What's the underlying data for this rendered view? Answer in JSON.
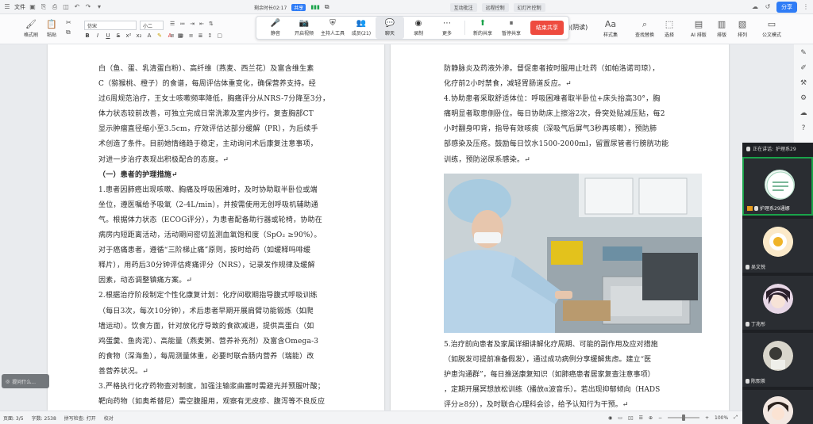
{
  "titlebar": {
    "file_menu": "文件",
    "share_label": "分享"
  },
  "meeting": {
    "timer": "剩余时长02:17",
    "badge": "共享",
    "tabs": [
      "互动批注",
      "远程控制",
      "幻灯片控制"
    ],
    "items": [
      {
        "label": "静音",
        "icon": "microphone-icon"
      },
      {
        "label": "开启视频",
        "icon": "camera-icon"
      },
      {
        "label": "主持人工具",
        "icon": "shield-icon"
      },
      {
        "label": "成员(21)",
        "icon": "members-icon"
      },
      {
        "label": "聊天",
        "icon": "chat-icon"
      },
      {
        "label": "录制",
        "icon": "record-icon"
      },
      {
        "label": "更多",
        "icon": "more-icon"
      },
      {
        "label": "新的共享",
        "icon": "new-share-icon"
      },
      {
        "label": "暂停共享",
        "icon": "pause-share-icon"
      }
    ],
    "end_share": "结束共享"
  },
  "ribbon": {
    "left_buttons": [
      "格式刷",
      "粘贴"
    ],
    "font_name": "仿宋",
    "font_size": "小二",
    "style_label": "通(阴读)",
    "right_buttons": [
      "样式集",
      "查找替换",
      "选择",
      "AI 排版",
      "排版",
      "排列",
      "公文模式"
    ]
  },
  "doc": {
    "left_lines": [
      "白（鱼、蛋、乳清蛋白粉）、高纤维（燕麦、西兰花）及富含维生素",
      "C（猕猴桃、橙子）的食谱，每周评估体重变化，确保营养支持。经",
      "过6周规范治疗，王女士咳嗽频率降低，胸痛评分从NRS-7分降至3分，",
      "体力状态较前改善，可独立完成日常洗漱及室内步行。复查胸部CT",
      "显示肿瘤直径缩小至3.5cm，疗效评估达部分缓解（PR），为后续手",
      "术创造了条件。目前她情绪趋于稳定，主动询问术后康复注意事项，",
      "对进一步治疗表现出积极配合的态度。↵"
    ],
    "left_heading": "（一）患者的护理措施↵",
    "left_lines2": [
      "1.患者因肺癌出现咳嗽、胸痛及呼吸困难时，及时协助取半卧位或端",
      "坐位，遵医嘱给予吸氧（2-4L/min），并按需使用无创呼吸机辅助通",
      "气。根据体力状态（ECOG评分），为患者配备助行器或轮椅，协助在",
      "病房内短距离活动，活动期间密切监测血氧饱和度（SpO₂ ≥90%）。",
      "对于癌痛患者，遵循“三阶梯止痛”原则，按时给药（如缓释吗啡缓",
      "释片），用药后30分钟评估疼痛评分（NRS），记录发作规律及缓解",
      "因素，动态调整镇痛方案。↵",
      "2.根据治疗阶段制定个性化康复计划：化疗间歇期指导腹式呼吸训练",
      "（每日3次，每次10分钟），术后患者早期开展肩臂功能锻炼（如爬",
      "墙运动）。饮食方面，针对放化疗导致的食欲减退，提供高蛋白（如",
      "鸡蛋羹、鱼肉泥）、高能量（燕麦粥、营养补充剂）及富含Omega-3",
      "的食物（深海鱼），每周测量体重，必要时联合肠内营养（瑞能）改",
      "善营养状况。↵",
      "3.严格执行化疗药物查对制度，加强注输浆曲塞时需避光并预服叶酸；",
      "靶向药物（如奥希替尼）需空腹服用，观察有无皮疹、腹泻等不良反应"
    ],
    "right_lines": [
      "防静脉炎及药液外渗。督促患者按时服用止吐药（如帕洛诺司琼），",
      "化疗前2小时禁食，减轻胃肠道反应。↵",
      "4.协助患者采取舒适体位：呼吸困难者取半卧位+床头抬高30°，胸",
      "痛明显者取患侧卧位。每日协助床上擦浴2次，骨突处贴减压贴，每2",
      "小时翻身叩背，指导有效咳痰（深吸气后屏气3秒再咳嗽），预防肺",
      "部感染及压疮。鼓励每日饮水1500-2000ml，留置尿管者行膀胱功能",
      "训练，预防泌尿系感染。↵"
    ],
    "right_lines2": [
      "5.治疗前向患者及家属详细讲解化疗周期、可能的副作用及应对措施",
      "（如脱发可提前准备假发），通过成功病例分享缓解焦虑。建立“医",
      "护患沟通群”，每日推送康复知识（如肺癌患者居家复查注意事项）",
      "，定期开展冥想放松训练（播放α波音乐）。若出现抑郁倾向（HADS",
      "评分≥8分），及时联合心理科会诊，给予认知行为干预。↵"
    ]
  },
  "ask_chip": "提问什么...",
  "video": {
    "speaking": "正在讲话:",
    "speaker": "护理系29",
    "participants": [
      "护理系29通娜",
      "吴文悦",
      "丁兆彤",
      "陈熙茶"
    ]
  },
  "status": {
    "page": "页面: 3/5",
    "words": "字数: 2538",
    "spell": "拼写检查: 打开",
    "proof": "校对",
    "zoom": "100%"
  }
}
